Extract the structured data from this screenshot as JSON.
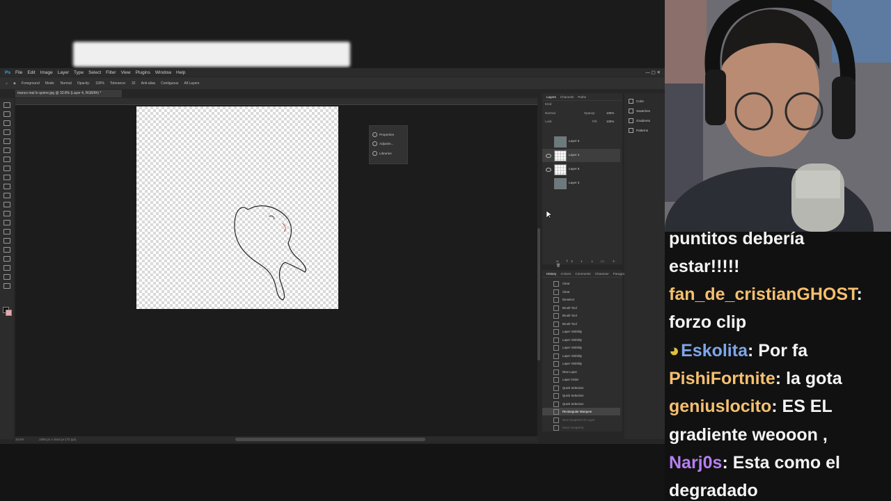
{
  "photoshop": {
    "menu": [
      "File",
      "Edit",
      "Image",
      "Layer",
      "Type",
      "Select",
      "Filter",
      "View",
      "Plugins",
      "Window",
      "Help"
    ],
    "options": [
      "Foreground",
      "Mode:",
      "Normal",
      "Opacity:",
      "100%",
      "Tolerance:",
      "32",
      "Anti-alias",
      "Contiguous",
      "All Layers"
    ],
    "doc_tab": "manco mal lo quiere.jpg @ 33.8% (Layer 4, RGB/8#) *",
    "floating_panel": [
      "Properties",
      "Adjustm...",
      "Libraries"
    ],
    "layers_tabs": [
      "Layers",
      "Channels",
      "Paths"
    ],
    "layers_kind": "Kind",
    "blend_mode": "Normal",
    "opacity_label": "Opacity:",
    "opacity_value": "100%",
    "lock_label": "Lock:",
    "fill_label": "Fill:",
    "fill_value": "100%",
    "layers": [
      "Layer 5",
      "Layer 4",
      "Layer 6",
      "Layer 3"
    ],
    "history_tabs": [
      "History",
      "Actions",
      "Comments",
      "Character",
      "Paragraph"
    ],
    "history": [
      "Clear",
      "Clear",
      "Deselect",
      "Brush Tool",
      "Brush Tool",
      "Brush Tool",
      "Layer Visibility",
      "Layer Visibility",
      "Layer Visibility",
      "Layer Visibility",
      "Layer Visibility",
      "New Layer",
      "Layer Order",
      "Quick Selection",
      "Quick Selection",
      "Quick Selection",
      "Rectangular Marquee",
      "New Snapshot Of Layer",
      "Move Snapshot"
    ],
    "right_dock": [
      "Color",
      "Swatches",
      "Gradients",
      "Patterns"
    ],
    "status_zoom": "33.8%",
    "status_doc": "1080 px x 1644 px (72 ppi)"
  },
  "chat": [
    {
      "user": "",
      "text": "puntitos debería",
      "user_color": "#f4f4f4"
    },
    {
      "user": "",
      "text": "estar!!!!!",
      "user_color": "#f4f4f4"
    },
    {
      "user": "fan_de_cristianGHOST",
      "text": "",
      "user_color": "#f5c06f"
    },
    {
      "user": "",
      "text": "forzo clip",
      "user_color": "#f4f4f4"
    },
    {
      "user": "Eskolita",
      "text": "Por fa",
      "user_color": "#7ea6e8"
    },
    {
      "user": "PishiFortnite",
      "text": "la gota",
      "user_color": "#f5c06f"
    },
    {
      "user": "geniuslocito",
      "text": "ES EL",
      "user_color": "#f5c06f"
    },
    {
      "user": "",
      "text": "gradiente weooon ,",
      "user_color": "#f4f4f4"
    },
    {
      "user": "Narj0s",
      "text": "Esta como el",
      "user_color": "#b57ff0"
    },
    {
      "user": "",
      "text": "degradado",
      "user_color": "#f4f4f4"
    }
  ]
}
